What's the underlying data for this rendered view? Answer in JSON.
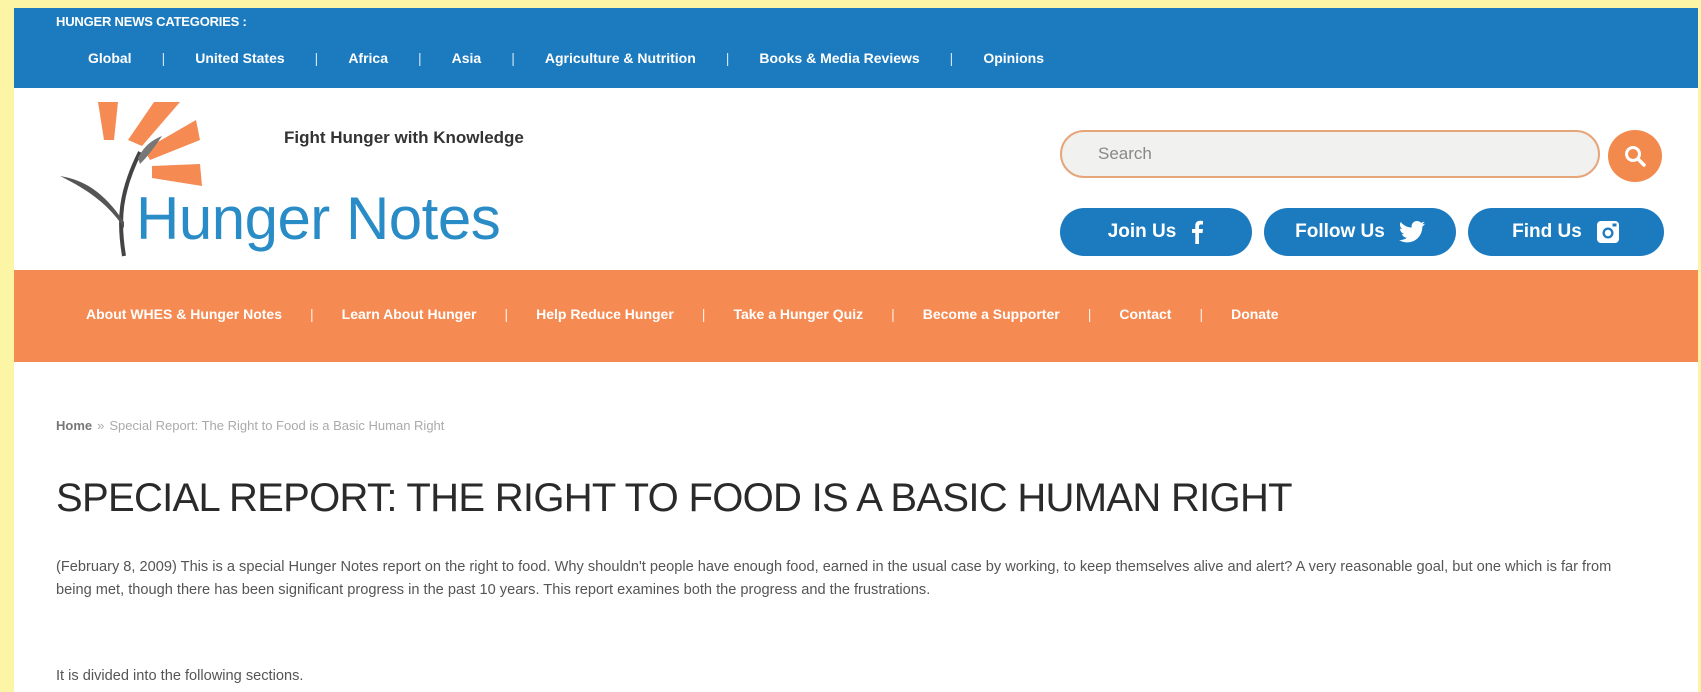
{
  "categories": {
    "title": "HUNGER NEWS CATEGORIES :",
    "items": [
      "Global",
      "United States",
      "Africa",
      "Asia",
      "Agriculture & Nutrition",
      "Books & Media Reviews",
      "Opinions"
    ]
  },
  "header": {
    "tagline": "Fight Hunger with Knowledge",
    "brand": "Hunger Notes",
    "search_placeholder": "Search",
    "social": [
      {
        "label": "Join Us",
        "icon": "facebook-icon"
      },
      {
        "label": "Follow Us",
        "icon": "twitter-icon"
      },
      {
        "label": "Find Us",
        "icon": "instagram-icon"
      }
    ]
  },
  "nav": {
    "items": [
      "About WHES & Hunger Notes",
      "Learn About Hunger",
      "Help Reduce Hunger",
      "Take a Hunger Quiz",
      "Become a Supporter",
      "Contact",
      "Donate"
    ]
  },
  "breadcrumb": {
    "home": "Home",
    "separator": "»",
    "current": "Special Report: The Right to Food is a Basic Human Right"
  },
  "article": {
    "title": "SPECIAL REPORT: THE RIGHT TO FOOD IS A BASIC HUMAN RIGHT",
    "intro": "(February 8, 2009) This is a special Hunger Notes report on the right to food. Why shouldn't people have enough food, earned in the usual case by working, to keep themselves alive and alert? A very reasonable goal, but one which is far from being met, though there has been significant progress in the past 10 years. This report examines both the progress and the frustrations.",
    "sections_line": "It is divided into the following sections."
  },
  "colors": {
    "blue": "#1c7bbf",
    "orange": "#f58b53",
    "brand_blue": "#2a8cc6",
    "page_border": "#fdf5a6"
  }
}
